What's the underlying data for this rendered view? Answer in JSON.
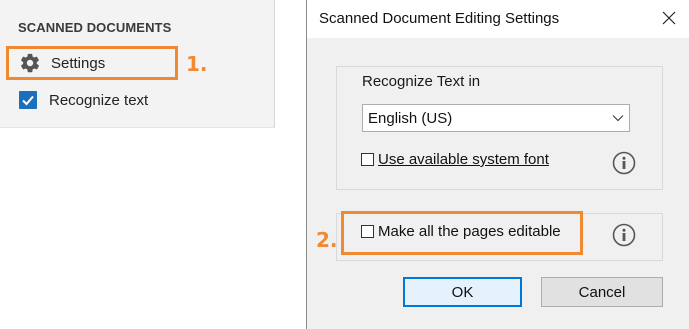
{
  "left_panel": {
    "heading": "SCANNED DOCUMENTS",
    "settings_label": "Settings",
    "settings_icon": "gear-icon",
    "recognize_label": "Recognize text",
    "recognize_checked": true
  },
  "dialog": {
    "title": "Scanned Document Editing Settings",
    "recognize_text_in_label": "Recognize Text in",
    "language_selected": "English (US)",
    "use_system_font_label": "Use available system font",
    "use_system_font_checked": false,
    "make_editable_label": "Make all the pages editable",
    "make_editable_checked": false,
    "ok_label": "OK",
    "cancel_label": "Cancel"
  },
  "annotations": {
    "step_1": "1.",
    "step_2": "2."
  },
  "colors": {
    "callout": "#ef8a32",
    "checkbox_blue": "#1c6fbd",
    "ok_border": "#0078d7"
  }
}
